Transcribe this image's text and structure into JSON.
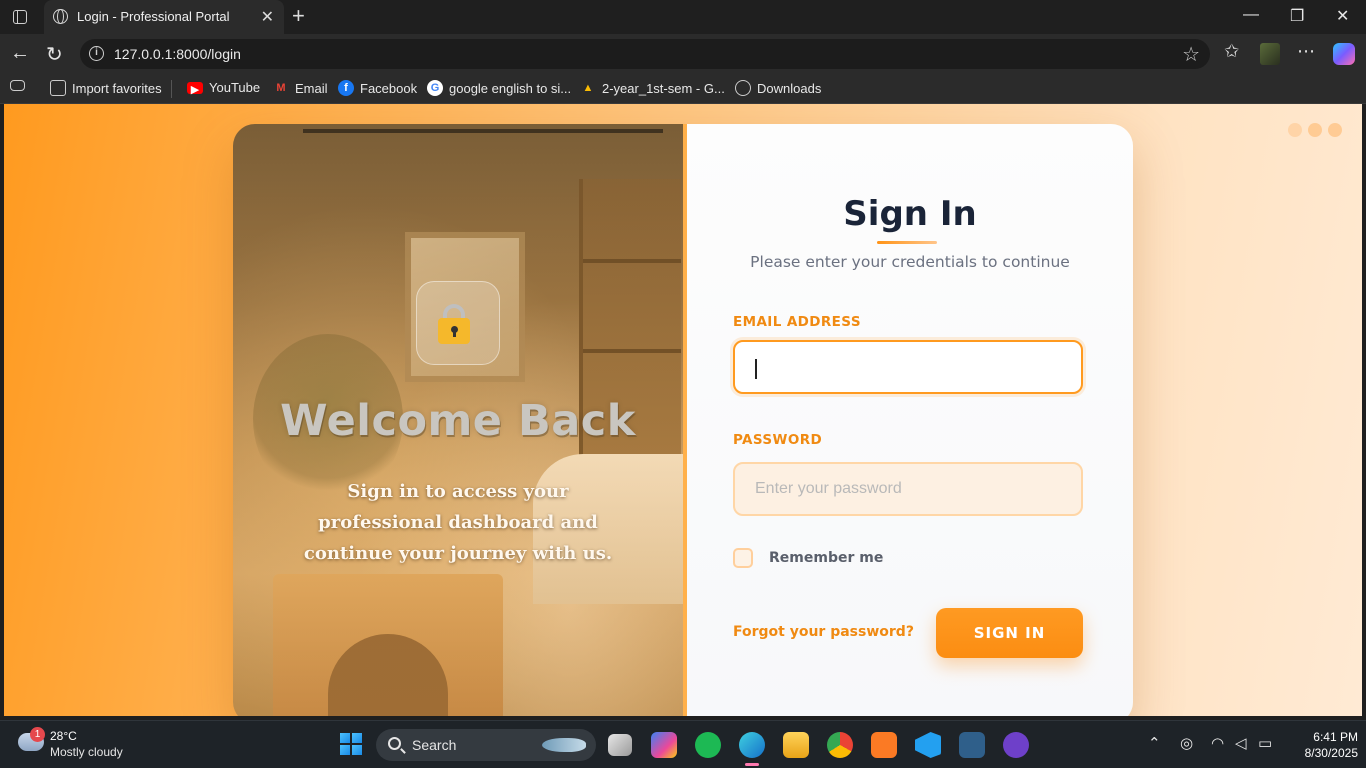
{
  "browser": {
    "tab_title": "Login - Professional Portal",
    "new_tab": "+",
    "url": "127.0.0.1:8000/login",
    "bookmarks": [
      {
        "label": "Import favorites",
        "icon": "import-icon"
      },
      {
        "label": "YouTube",
        "icon": "youtube-icon",
        "color": "#ff0000"
      },
      {
        "label": "Email",
        "icon": "gmail-icon",
        "color": "#ea4335"
      },
      {
        "label": "Facebook",
        "icon": "facebook-icon",
        "color": "#1877f2"
      },
      {
        "label": "google english to si...",
        "icon": "google-icon",
        "color": "#4285f4"
      },
      {
        "label": "2-year_1st-sem - G...",
        "icon": "drive-icon",
        "color": "#fbbc04"
      },
      {
        "label": "Downloads",
        "icon": "globe-icon"
      }
    ]
  },
  "hero": {
    "heading": "Welcome Back",
    "subtitle": "Sign in to access your professional dashboard and continue your journey with us."
  },
  "form": {
    "title": "Sign In",
    "subtitle": "Please enter your credentials to continue",
    "email_label": "EMAIL ADDRESS",
    "email_value": "",
    "password_label": "PASSWORD",
    "password_placeholder": "Enter your password",
    "remember_label": "Remember me",
    "remember_checked": false,
    "forgot_label": "Forgot your password?",
    "submit_label": "SIGN IN",
    "accent_color": "#ff9a1f"
  },
  "taskbar": {
    "weather_badge": "1",
    "temperature": "28°C",
    "condition": "Mostly cloudy",
    "search_label": "Search",
    "time": "6:41 PM",
    "date": "8/30/2025"
  }
}
